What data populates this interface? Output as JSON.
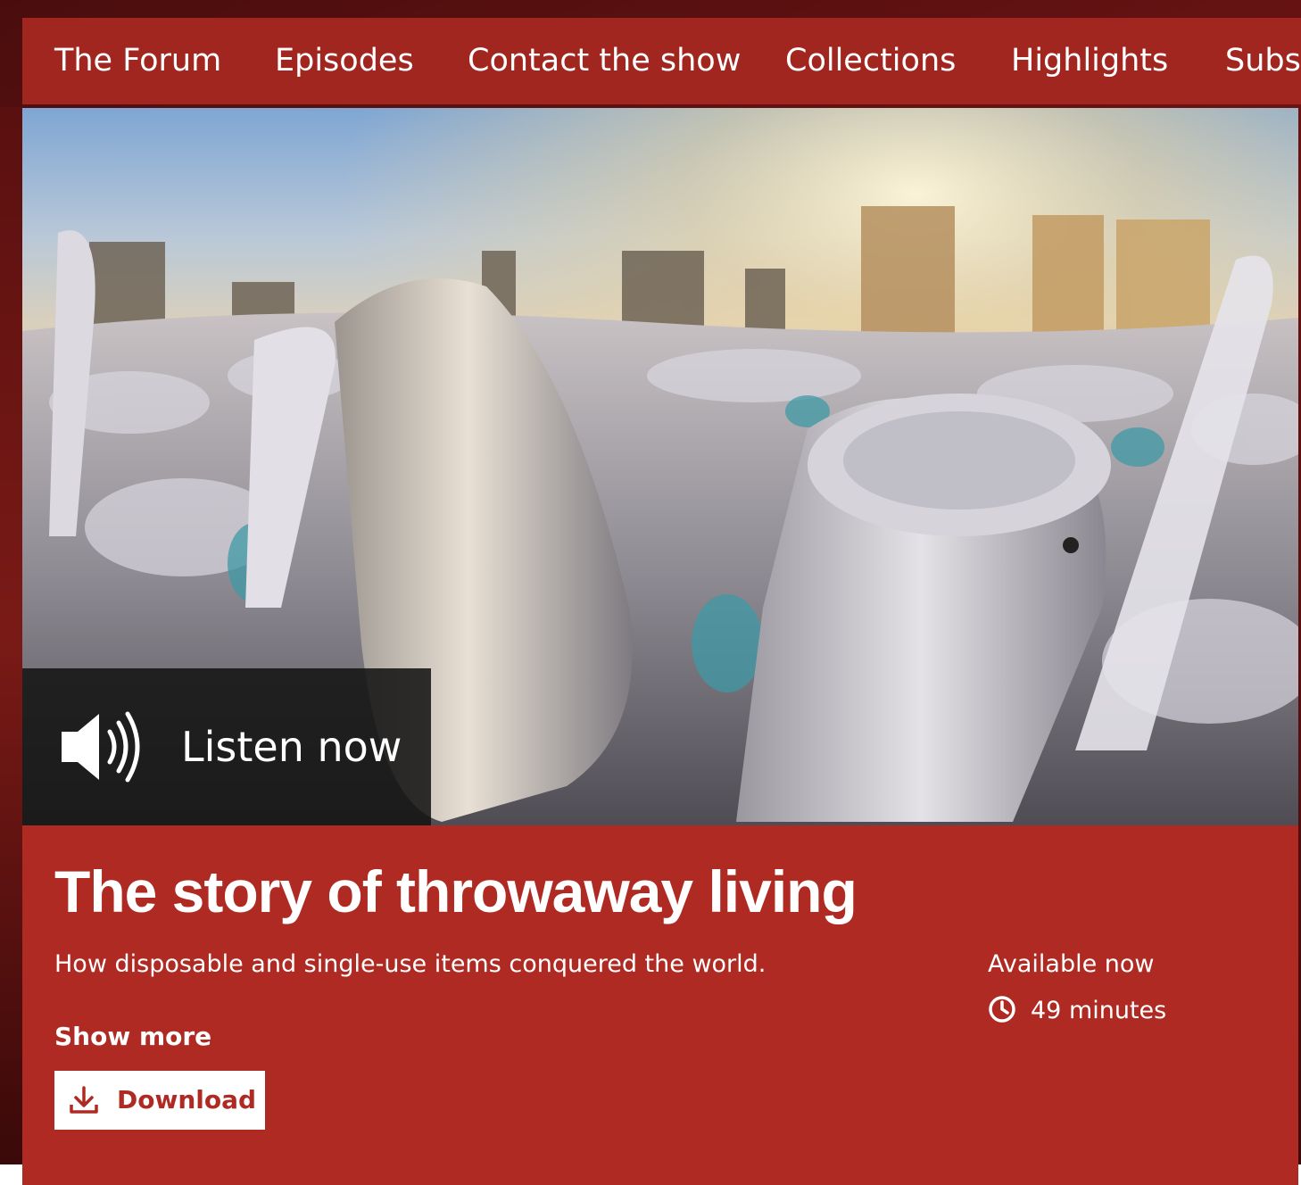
{
  "nav": {
    "items": [
      {
        "label": "The Forum"
      },
      {
        "label": "Episodes"
      },
      {
        "label": "Contact the show"
      },
      {
        "label": "Collections"
      },
      {
        "label": "Highlights"
      },
      {
        "label": "Subscribe"
      }
    ]
  },
  "hero": {
    "listen_label": "Listen now",
    "icon": "speaker-icon"
  },
  "episode": {
    "title": "The story of throwaway living",
    "description": "How disposable and single-use items conquered the world.",
    "show_more": "Show more",
    "download_label": "Download",
    "availability": "Available now",
    "duration": "49 minutes"
  },
  "colors": {
    "brand_red": "#ae2a22",
    "nav_red": "#a1261f"
  }
}
